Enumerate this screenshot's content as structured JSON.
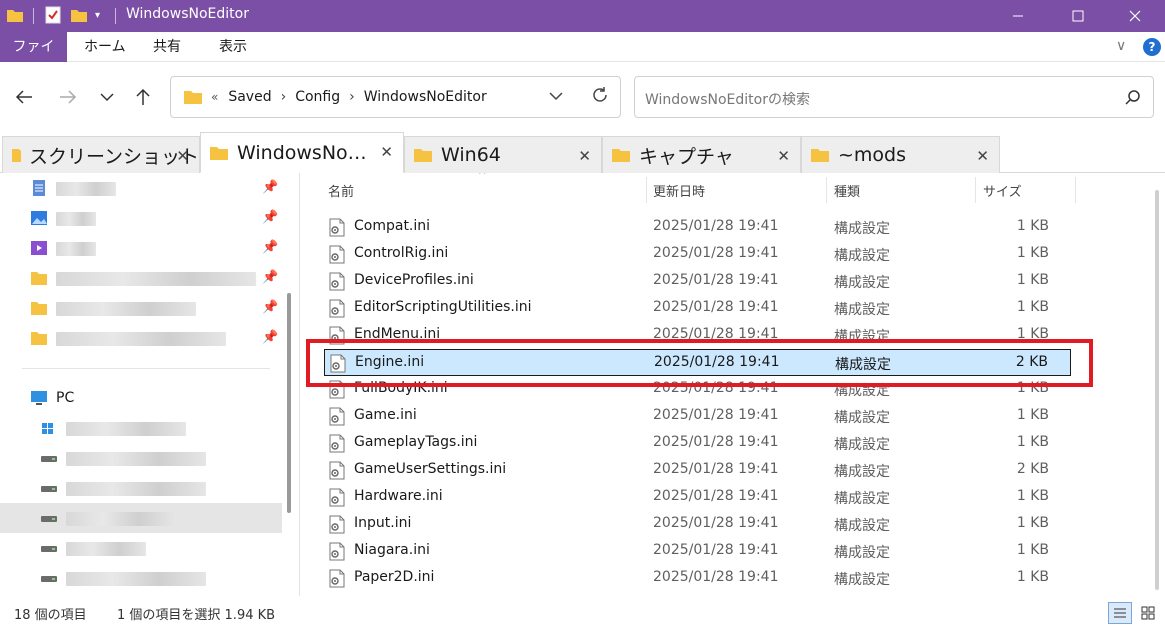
{
  "window": {
    "title": "WindowsNoEditor",
    "accent": "#7b4fa6"
  },
  "ribbon": {
    "tabs": [
      "ファイル",
      "ホーム",
      "共有",
      "表示"
    ]
  },
  "address": {
    "overflow": "«",
    "crumbs": [
      "Saved",
      "Config",
      "WindowsNoEditor"
    ]
  },
  "search": {
    "placeholder": "WindowsNoEditorの検索"
  },
  "tabs": [
    {
      "label": "スクリーンショット",
      "icon": "folder-icon",
      "active": false
    },
    {
      "label": "WindowsNo…",
      "icon": "folder-icon",
      "active": true
    },
    {
      "label": "Win64",
      "icon": "folder-icon",
      "active": false
    },
    {
      "label": "キャプチャ",
      "icon": "folder-icon",
      "active": false
    },
    {
      "label": "~mods",
      "icon": "folder-icon",
      "active": false
    }
  ],
  "sidebar": {
    "pc_label": "PC"
  },
  "columns": {
    "name": "名前",
    "date": "更新日時",
    "type": "種類",
    "size": "サイズ"
  },
  "files": [
    {
      "name": "Compat.ini",
      "date": "2025/01/28 19:41",
      "type": "構成設定",
      "size": "1 KB"
    },
    {
      "name": "ControlRig.ini",
      "date": "2025/01/28 19:41",
      "type": "構成設定",
      "size": "1 KB"
    },
    {
      "name": "DeviceProfiles.ini",
      "date": "2025/01/28 19:41",
      "type": "構成設定",
      "size": "1 KB"
    },
    {
      "name": "EditorScriptingUtilities.ini",
      "date": "2025/01/28 19:41",
      "type": "構成設定",
      "size": "1 KB"
    },
    {
      "name": "EndMenu.ini",
      "date": "2025/01/28 19:41",
      "type": "構成設定",
      "size": "1 KB"
    },
    {
      "name": "Engine.ini",
      "date": "2025/01/28 19:41",
      "type": "構成設定",
      "size": "2 KB",
      "selected": true
    },
    {
      "name": "FullBodyIK.ini",
      "date": "2025/01/28 19:41",
      "type": "構成設定",
      "size": "1 KB"
    },
    {
      "name": "Game.ini",
      "date": "2025/01/28 19:41",
      "type": "構成設定",
      "size": "1 KB"
    },
    {
      "name": "GameplayTags.ini",
      "date": "2025/01/28 19:41",
      "type": "構成設定",
      "size": "1 KB"
    },
    {
      "name": "GameUserSettings.ini",
      "date": "2025/01/28 19:41",
      "type": "構成設定",
      "size": "2 KB"
    },
    {
      "name": "Hardware.ini",
      "date": "2025/01/28 19:41",
      "type": "構成設定",
      "size": "1 KB"
    },
    {
      "name": "Input.ini",
      "date": "2025/01/28 19:41",
      "type": "構成設定",
      "size": "1 KB"
    },
    {
      "name": "Niagara.ini",
      "date": "2025/01/28 19:41",
      "type": "構成設定",
      "size": "1 KB"
    },
    {
      "name": "Paper2D.ini",
      "date": "2025/01/28 19:41",
      "type": "構成設定",
      "size": "1 KB"
    }
  ],
  "status": {
    "count": "18 個の項目",
    "selection": "1 個の項目を選択  1.94 KB"
  },
  "colors": {
    "selection_bg": "#cce8ff",
    "highlight": "#e01b24",
    "folder": "#f5c242"
  }
}
